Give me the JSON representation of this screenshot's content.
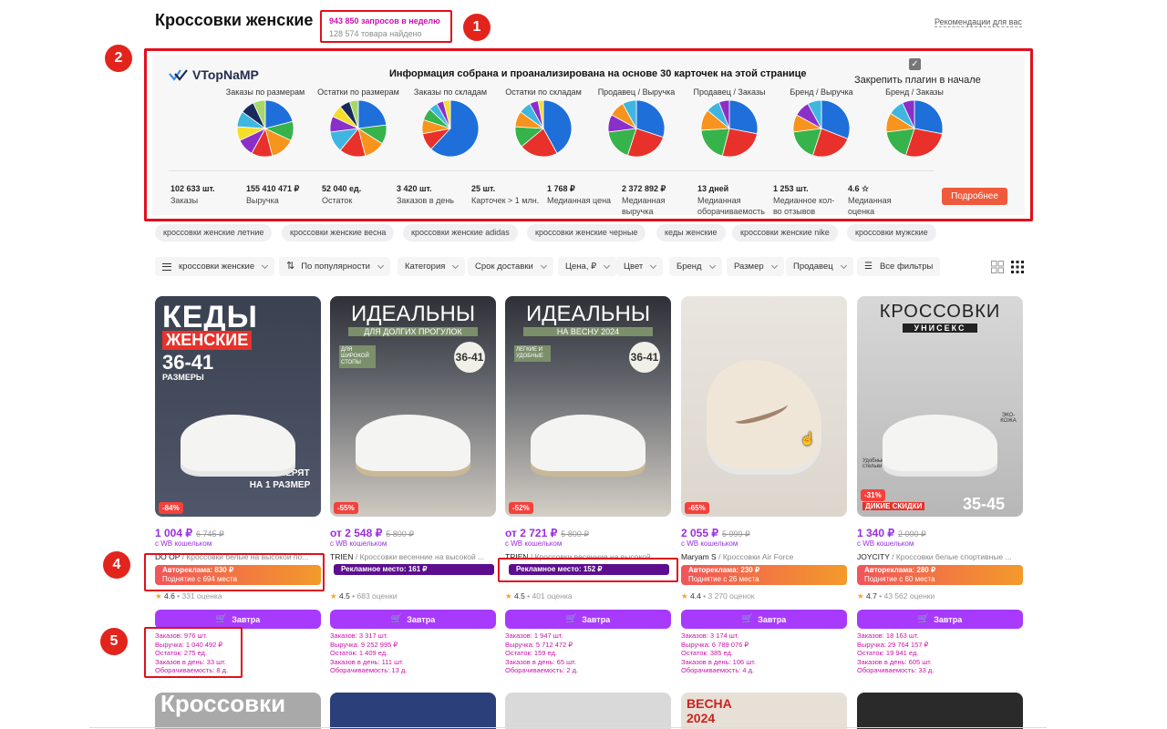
{
  "header": {
    "title": "Кроссовки женские",
    "queries": "943 850 запросов в неделю",
    "found": "128 574 товара найдено",
    "recommendations": "Рекомендации для вас"
  },
  "markers": [
    "1",
    "2",
    "3",
    "4",
    "5"
  ],
  "plugin": {
    "logo": "VTopNaMP",
    "heading": "Информация собрана и проанализирована на основе 30 карточек на этой странице",
    "pin_label": "Закрепить плагин в начале",
    "pin_checked": true,
    "pie_titles": [
      "Заказы по размерам",
      "Остатки по размерам",
      "Заказы по складам",
      "Остатки по складам",
      "Продавец / Выручка",
      "Продавец / Заказы",
      "Бренд / Выручка",
      "Бренд / Заказы"
    ],
    "pies": [
      [
        {
          "v": 21,
          "c": "#1e6fd9"
        },
        {
          "v": 11,
          "c": "#36b34a"
        },
        {
          "v": 14,
          "c": "#f7941d"
        },
        {
          "v": 12,
          "c": "#e8312a"
        },
        {
          "v": 10,
          "c": "#8b2fc9"
        },
        {
          "v": 8,
          "c": "#f5dd2a"
        },
        {
          "v": 9,
          "c": "#3fb6e0"
        },
        {
          "v": 8,
          "c": "#1a2a5c"
        },
        {
          "v": 7,
          "c": "#a6d96a"
        }
      ],
      [
        {
          "v": 23,
          "c": "#1e6fd9"
        },
        {
          "v": 11,
          "c": "#36b34a"
        },
        {
          "v": 12,
          "c": "#f7941d"
        },
        {
          "v": 15,
          "c": "#e8312a"
        },
        {
          "v": 12,
          "c": "#3fb6e0"
        },
        {
          "v": 9,
          "c": "#8b2fc9"
        },
        {
          "v": 7,
          "c": "#f5dd2a"
        },
        {
          "v": 6,
          "c": "#1a2a5c"
        },
        {
          "v": 5,
          "c": "#a6d96a"
        }
      ],
      [
        {
          "v": 62,
          "c": "#1e6fd9"
        },
        {
          "v": 10,
          "c": "#e8312a"
        },
        {
          "v": 8,
          "c": "#f7941d"
        },
        {
          "v": 7,
          "c": "#36b34a"
        },
        {
          "v": 5,
          "c": "#3fb6e0"
        },
        {
          "v": 4,
          "c": "#8b2fc9"
        },
        {
          "v": 4,
          "c": "#f5dd2a"
        }
      ],
      [
        {
          "v": 42,
          "c": "#1e6fd9"
        },
        {
          "v": 22,
          "c": "#e8312a"
        },
        {
          "v": 12,
          "c": "#36b34a"
        },
        {
          "v": 9,
          "c": "#f7941d"
        },
        {
          "v": 7,
          "c": "#3fb6e0"
        },
        {
          "v": 5,
          "c": "#8b2fc9"
        },
        {
          "v": 3,
          "c": "#f5dd2a"
        }
      ],
      [
        {
          "v": 30,
          "c": "#1e6fd9"
        },
        {
          "v": 25,
          "c": "#e8312a"
        },
        {
          "v": 18,
          "c": "#36b34a"
        },
        {
          "v": 10,
          "c": "#8b2fc9"
        },
        {
          "v": 9,
          "c": "#f7941d"
        },
        {
          "v": 8,
          "c": "#3fb6e0"
        }
      ],
      [
        {
          "v": 28,
          "c": "#1e6fd9"
        },
        {
          "v": 26,
          "c": "#e8312a"
        },
        {
          "v": 20,
          "c": "#36b34a"
        },
        {
          "v": 12,
          "c": "#f7941d"
        },
        {
          "v": 8,
          "c": "#3fb6e0"
        },
        {
          "v": 6,
          "c": "#8b2fc9"
        }
      ],
      [
        {
          "v": 31,
          "c": "#1e6fd9"
        },
        {
          "v": 24,
          "c": "#e8312a"
        },
        {
          "v": 18,
          "c": "#36b34a"
        },
        {
          "v": 10,
          "c": "#f7941d"
        },
        {
          "v": 9,
          "c": "#8b2fc9"
        },
        {
          "v": 8,
          "c": "#3fb6e0"
        }
      ],
      [
        {
          "v": 28,
          "c": "#1e6fd9"
        },
        {
          "v": 27,
          "c": "#e8312a"
        },
        {
          "v": 18,
          "c": "#36b34a"
        },
        {
          "v": 11,
          "c": "#f7941d"
        },
        {
          "v": 9,
          "c": "#3fb6e0"
        },
        {
          "v": 7,
          "c": "#8b2fc9"
        }
      ]
    ],
    "stats": [
      {
        "value": "102 633 шт.",
        "label": "Заказы"
      },
      {
        "value": "155 410 471 ₽",
        "label": "Выручка"
      },
      {
        "value": "52 040 ед.",
        "label": "Остаток"
      },
      {
        "value": "3 420 шт.",
        "label": "Заказов в день"
      },
      {
        "value": "25 шт.",
        "label": "Карточек > 1 млн."
      },
      {
        "value": "1 768 ₽",
        "label": "Медианная цена"
      },
      {
        "value": "2 372 892 ₽",
        "label": "Медианная выручка"
      },
      {
        "value": "13 дней",
        "label": "Медианная оборачиваемость"
      },
      {
        "value": "1 253 шт.",
        "label": "Медианное кол-во отзывов"
      },
      {
        "value": "4.6 ☆",
        "label": "Медианная оценка"
      }
    ],
    "more_button": "Подробнее"
  },
  "chips": [
    "кроссовки женские летние",
    "кроссовки женские весна",
    "кроссовки женские adidas",
    "кроссовки женские черные",
    "кеды женские",
    "кроссовки женские nike",
    "кроссовки мужские"
  ],
  "filters": {
    "query": "кроссовки женские",
    "sort": "По популярности",
    "items": [
      "Категория",
      "Срок доставки",
      "Цена, ₽",
      "Цвет",
      "Бренд",
      "Размер",
      "Продавец"
    ],
    "all": "Все фильтры"
  },
  "cards": [
    {
      "banner": "КЕДЫ",
      "banner_sub": "ЖЕНСКИЕ",
      "banner_size": "36-41",
      "discount": "-84%",
      "price": "1 004 ₽",
      "old_price": "6 745 ₽",
      "wallet": "с WB кошельком",
      "brand": "DO OP",
      "title": "Кроссовки белые на высокой по...",
      "ad_line1": "Автореклама: 830 ₽",
      "ad_line2": "Поднятие с 694 места",
      "rating": "4.6",
      "reviews": "331 оценка",
      "buy": "Завтра",
      "stats": [
        "Заказов: 976 шт.",
        "Выручка: 1 040 492 ₽",
        "Остаток: 275 ед.",
        "Заказов в день: 33 шт.",
        "Оборачиваемость: 8 д."
      ]
    },
    {
      "banner": "ИДЕАЛЬНЫ",
      "banner_sub": "ДЛЯ ДОЛГИХ ПРОГУЛОК",
      "banner_size": "36-41",
      "discount": "-55%",
      "price": "от 2 548 ₽",
      "old_price": "5 800 ₽",
      "wallet": "с WB кошельком",
      "brand": "TRIEN",
      "title": "Кроссовки весенние на высокой ...",
      "ad_line1": "Рекламное место: 161 ₽",
      "ad_line2": "",
      "rating": "4.5",
      "reviews": "683 оценки",
      "buy": "Завтра",
      "stats": [
        "Заказов: 3 317 шт.",
        "Выручка: 9 252 995 ₽",
        "Остаток: 1 409 ед.",
        "Заказов в день: 111 шт.",
        "Оборачиваемость: 13 д."
      ]
    },
    {
      "banner": "ИДЕАЛЬНЫ",
      "banner_sub": "НА ВЕСНУ 2024",
      "banner_size": "36-41",
      "discount": "-52%",
      "price": "от 2 721 ₽",
      "old_price": "5 800 ₽",
      "wallet": "с WB кошельком",
      "brand": "TRIEN",
      "title": "Кроссовки весенние на высокой ...",
      "ad_line1": "Рекламное место: 152 ₽",
      "ad_line2": "",
      "rating": "4.5",
      "reviews": "401 оценка",
      "buy": "Завтра",
      "stats": [
        "Заказов: 1 947 шт.",
        "Выручка: 5 712 472 ₽",
        "Остаток: 159 ед.",
        "Заказов в день: 65 шт.",
        "Оборачиваемость: 2 д."
      ]
    },
    {
      "banner": "",
      "banner_sub": "",
      "banner_size": "",
      "discount": "-65%",
      "price": "2 055 ₽",
      "old_price": "5 999 ₽",
      "wallet": "с WB кошельком",
      "brand": "Maryam S",
      "title": "Кроссовки Air Force",
      "ad_line1": "Автореклама: 230 ₽",
      "ad_line2": "Поднятие с 26 места",
      "rating": "4.4",
      "reviews": "3 270 оценок",
      "buy": "Завтра",
      "stats": [
        "Заказов: 3 174 шт.",
        "Выручка: 6 789 076 ₽",
        "Остаток: 385 ед.",
        "Заказов в день: 106 шт.",
        "Оборачиваемость: 4 д."
      ]
    },
    {
      "banner": "КРОССОВКИ",
      "banner_sub": "УНИСЕКС",
      "banner_size": "35-45",
      "discount": "-31%",
      "price": "1 340 ₽",
      "old_price": "2 000 ₽",
      "wallet": "с WB кошельком",
      "brand": "JOYCITY",
      "title": "Кроссовки белые спортивные ...",
      "ad_line1": "Автореклама: 280 ₽",
      "ad_line2": "Поднятие с 60 места",
      "rating": "4.7",
      "reviews": "43 562 оценки",
      "buy": "Завтра",
      "stats": [
        "Заказов: 18 163 шт.",
        "Выручка: 29 764 157 ₽",
        "Остаток: 19 941 ед.",
        "Заказов в день: 605 шт.",
        "Оборачиваемость: 33 д."
      ]
    }
  ],
  "card_extras": {
    "badge_card2": "ДЛЯ ШИРОКОЙ СТОПЫ",
    "badge_card3": "ЛЕГКИЕ И УДОБНЫЕ",
    "footer_card1": "МАЛОМЕРЯТ НА 1 РАЗМЕР",
    "footer_card5": "ДИКИЕ СКИДКИ",
    "sizes_label_card1": "РАЗМЕРЫ",
    "insoles_card5": "Удобные стельки",
    "eco_card5": "ЭКО-КОЖА"
  },
  "bottom_row": [
    "Кроссовки",
    "",
    "",
    "ВЕСНА 2024",
    ""
  ]
}
